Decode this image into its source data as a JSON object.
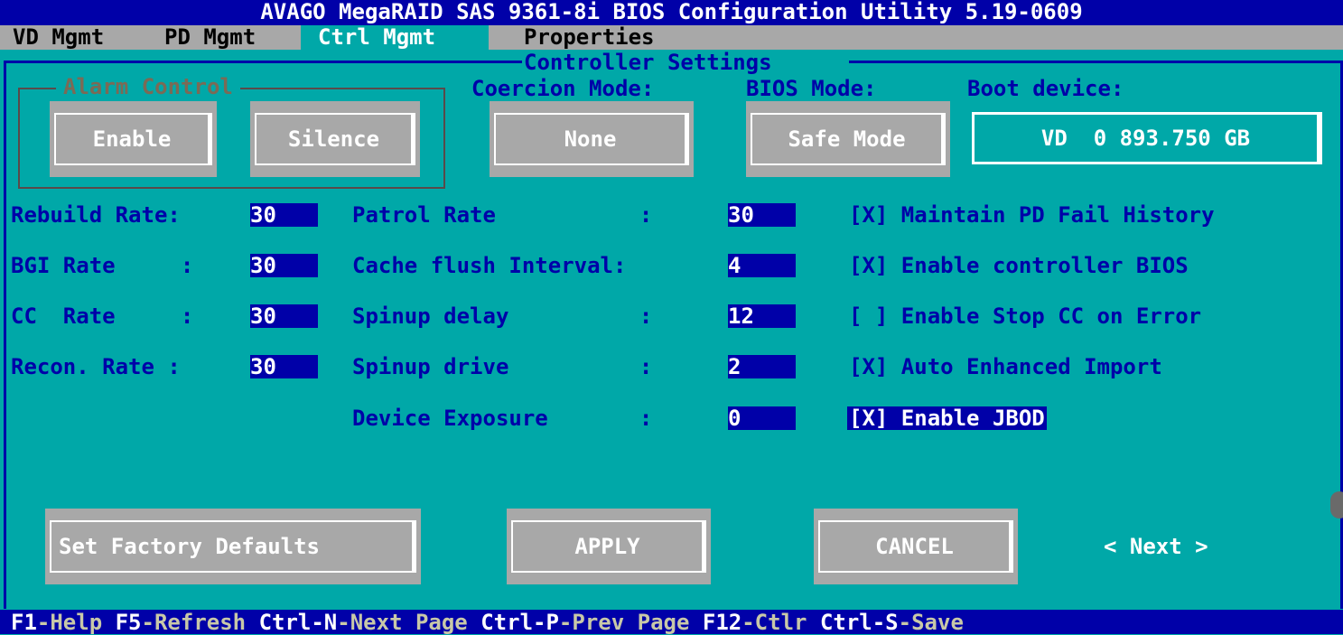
{
  "title": "AVAGO MegaRAID SAS 9361-8i BIOS Configuration Utility 5.19-0609",
  "tabs": [
    "VD Mgmt",
    "PD Mgmt",
    "Ctrl Mgmt",
    "Properties"
  ],
  "active_tab": "Ctrl Mgmt",
  "section_title": "Controller Settings",
  "alarm": {
    "title": "Alarm Control",
    "enable_label": "Enable",
    "silence_label": "Silence"
  },
  "coercion": {
    "label": "Coercion Mode:",
    "value": "None"
  },
  "bios_mode": {
    "label": "BIOS Mode:",
    "value": "Safe Mode"
  },
  "boot_device": {
    "label": "Boot device:",
    "value": "VD  0 893.750 GB"
  },
  "rates": [
    {
      "label": "Rebuild Rate:",
      "value": "30"
    },
    {
      "label": "BGI Rate     :",
      "value": "30"
    },
    {
      "label": "CC  Rate     :",
      "value": "30"
    },
    {
      "label": "Recon. Rate :",
      "value": "30"
    }
  ],
  "settings": [
    {
      "label": "Patrol Rate           :",
      "value": "30"
    },
    {
      "label": "Cache flush Interval:",
      "value": "4"
    },
    {
      "label": "Spinup delay          :",
      "value": "12"
    },
    {
      "label": "Spinup drive          :",
      "value": "2"
    },
    {
      "label": "Device Exposure       :",
      "value": "0"
    }
  ],
  "options": [
    {
      "label": "[X] Maintain PD Fail History"
    },
    {
      "label": "[X] Enable controller BIOS"
    },
    {
      "label": "[ ] Enable Stop CC on Error"
    },
    {
      "label": "[X] Auto Enhanced Import"
    },
    {
      "label": "[X] Enable JBOD"
    }
  ],
  "buttons": {
    "factory": "Set Factory Defaults",
    "apply": "APPLY",
    "cancel": "CANCEL",
    "next": "< Next >"
  },
  "footer": [
    {
      "key": "F1",
      "desc": "-Help"
    },
    {
      "key": "F5",
      "desc": "-Refresh"
    },
    {
      "key": "Ctrl-N",
      "desc": "-Next Page"
    },
    {
      "key": "Ctrl-P",
      "desc": "-Prev Page"
    },
    {
      "key": "F12",
      "desc": "-Ctlr"
    },
    {
      "key": "Ctrl-S",
      "desc": "-Save"
    }
  ],
  "colors": {
    "background": "#00a8a8",
    "accent_blue": "#0000a8",
    "button_gray": "#a8a8a8",
    "text_white": "#ffffff"
  }
}
